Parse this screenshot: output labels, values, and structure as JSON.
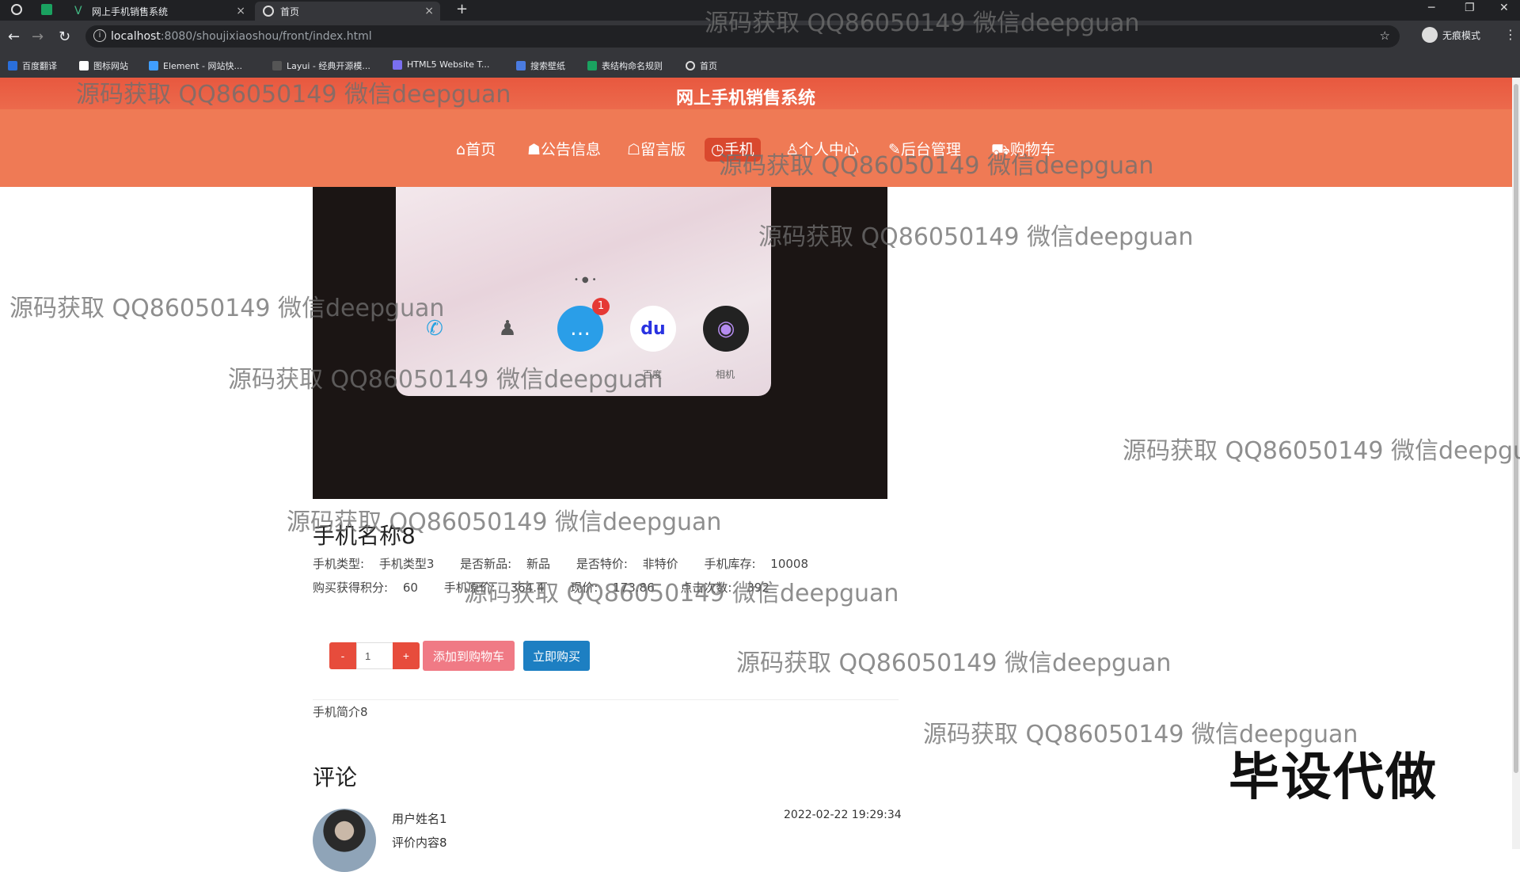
{
  "browser": {
    "tabs": [
      {
        "title": "网上手机销售系统",
        "active": false
      },
      {
        "title": "首页",
        "active": true
      }
    ],
    "new_tab": "+",
    "url_host": "localhost",
    "url_rest": ":8080/shoujixiaoshou/front/index.html",
    "profile_label": "无痕模式",
    "bookmarks": [
      "百度翻译",
      "图标网站",
      "Element - 网站快...",
      "Layui - 经典开源模...",
      "HTML5 Website T...",
      "搜索壁纸",
      "表结构命名规则",
      "首页"
    ]
  },
  "site": {
    "title": "网上手机销售系统",
    "nav": [
      {
        "icon": "home-icon",
        "glyph": "⌂",
        "label": "首页"
      },
      {
        "icon": "announcement-icon",
        "glyph": "☗",
        "label": "公告信息"
      },
      {
        "icon": "message-icon",
        "glyph": "☖",
        "label": "留言版"
      },
      {
        "icon": "phone-icon",
        "glyph": "◷",
        "label": "手机",
        "active": true
      },
      {
        "icon": "user-icon",
        "glyph": "♙",
        "label": "个人中心"
      },
      {
        "icon": "admin-icon",
        "glyph": "✎",
        "label": "后台管理"
      },
      {
        "icon": "cart-icon",
        "glyph": "⛟",
        "label": "购物车"
      }
    ]
  },
  "product": {
    "image_apps": [
      {
        "icon": "call-app-icon",
        "glyph": "✆",
        "label": ""
      },
      {
        "icon": "contacts-app-icon",
        "glyph": "👤",
        "label": ""
      },
      {
        "icon": "messages-app-icon",
        "glyph": "💬",
        "label": "",
        "badge": "1"
      },
      {
        "icon": "baidu-app-icon",
        "glyph": "du",
        "label": "百度"
      },
      {
        "icon": "camera-app-icon",
        "glyph": "◉",
        "label": "相机"
      }
    ],
    "name": "手机名称8",
    "meta_row1": [
      {
        "label": "手机类型:",
        "value": "手机类型3"
      },
      {
        "label": "是否新品:",
        "value": "新品"
      },
      {
        "label": "是否特价:",
        "value": "非特价"
      },
      {
        "label": "手机库存:",
        "value": "10008"
      }
    ],
    "meta_row2": [
      {
        "label": "购买获得积分:",
        "value": "60"
      },
      {
        "label": "手机原价:",
        "value": "364.4"
      },
      {
        "label": "现价:",
        "value": "173.86"
      },
      {
        "label": "点击次数:",
        "value": "392"
      }
    ],
    "quantity": "1",
    "minus_label": "-",
    "plus_label": "+",
    "add_to_cart": "添加到购物车",
    "buy_now": "立即购买",
    "intro": "手机简介8"
  },
  "comments": {
    "heading": "评论",
    "items": [
      {
        "user": "用户姓名1",
        "content": "评价内容8",
        "time": "2022-02-22 19:29:34"
      }
    ]
  },
  "watermark": "源码获取 QQ86050149 微信deepguan",
  "stamp": "毕设代做"
}
